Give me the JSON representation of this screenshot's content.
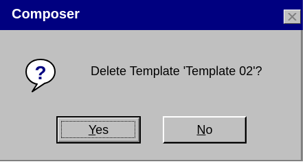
{
  "window": {
    "title": "Composer",
    "close_icon": "close-icon"
  },
  "message": {
    "icon": "question-icon",
    "text": "Delete Template 'Template 02'?"
  },
  "buttons": {
    "yes": {
      "mnemonic": "Y",
      "rest": "es"
    },
    "no": {
      "mnemonic": "N",
      "rest": "o"
    }
  },
  "colors": {
    "titlebar": "#000080",
    "face": "#c0c0c0",
    "icon_blue": "#000080"
  }
}
